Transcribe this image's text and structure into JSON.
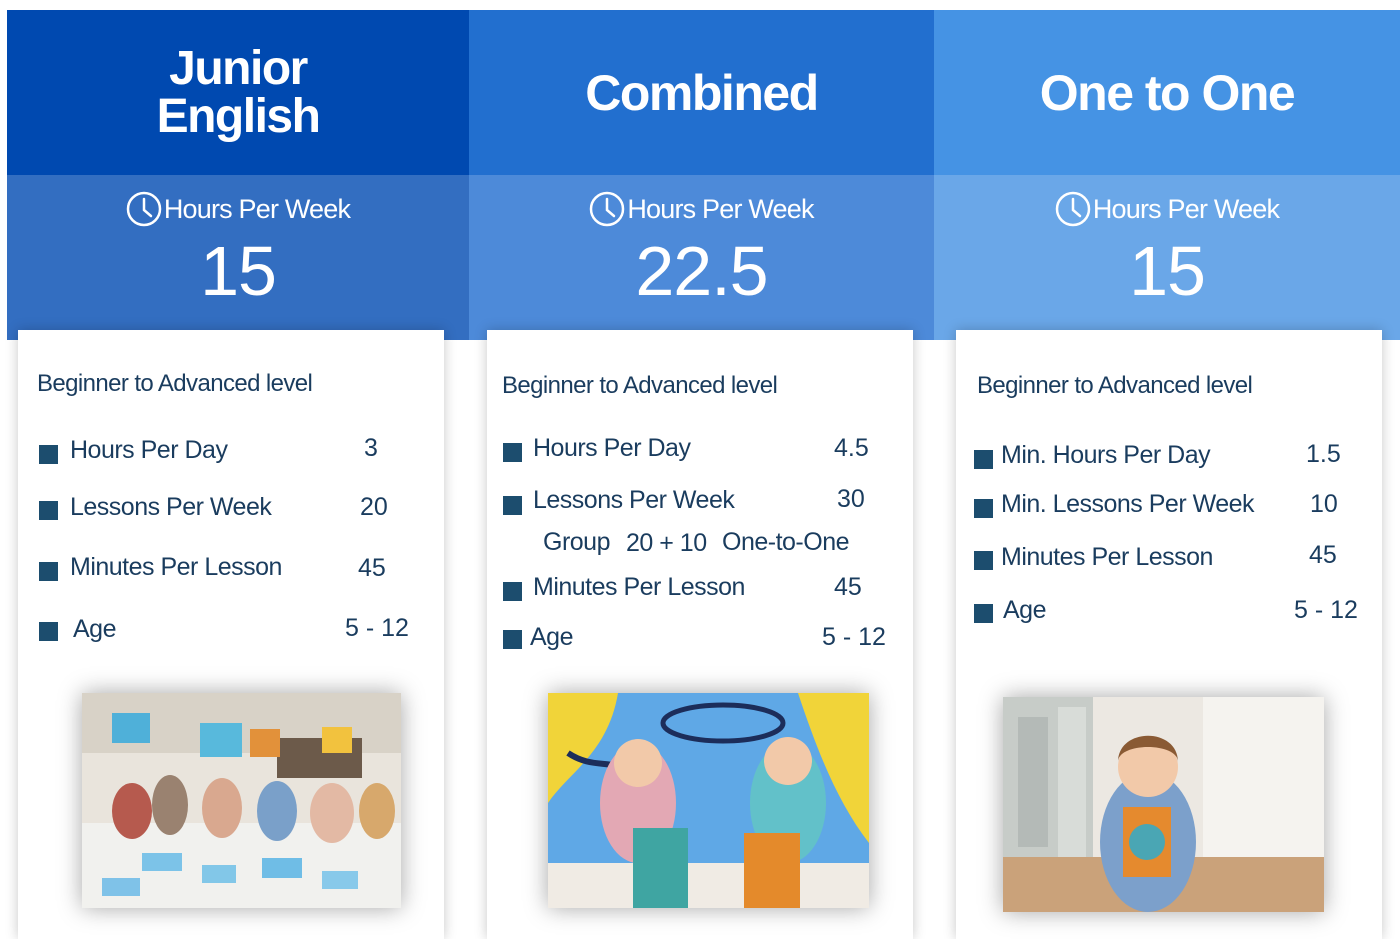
{
  "colors": {
    "col1_head": "#0049b0",
    "col1_band": "#336ec1",
    "col2_head": "#226fcf",
    "col2_band": "#4d8ad9",
    "col3_head": "#4593e4",
    "col3_band": "#6aa7e8",
    "bullet": "#1c4d6e",
    "text": "#1a3c5e"
  },
  "columns": [
    {
      "title_lines": [
        "Junior",
        "English"
      ],
      "hours_label": "Hours Per Week",
      "hours_value": "15",
      "level": "Beginner to Advanced level",
      "items": [
        {
          "label": "Hours Per Day",
          "value": "3"
        },
        {
          "label": "Lessons Per Week",
          "value": "20"
        },
        {
          "label": "Minutes Per Lesson",
          "value": "45"
        },
        {
          "label": "Age",
          "value": "5 - 12"
        }
      ],
      "photo": "children-classroom-photo"
    },
    {
      "title_lines": [
        "Combined"
      ],
      "hours_label": "Hours Per Week",
      "hours_value": "22.5",
      "level": "Beginner to Advanced level",
      "items": [
        {
          "label": "Hours Per Day",
          "value": "4.5"
        },
        {
          "label": "Lessons Per Week",
          "value": "30"
        },
        {
          "label": "Minutes Per Lesson",
          "value": "45"
        },
        {
          "label": "Age",
          "value": "5 - 12"
        }
      ],
      "sub": {
        "group": "Group",
        "mix": "20 + 10",
        "one": "One-to-One"
      },
      "photo": "two-girls-photo"
    },
    {
      "title_lines": [
        "One to One"
      ],
      "hours_label": "Hours Per Week",
      "hours_value": "15",
      "level": "Beginner to Advanced level",
      "items": [
        {
          "label": "Min. Hours Per Day",
          "value": "1.5"
        },
        {
          "label": "Min. Lessons Per Week",
          "value": "10"
        },
        {
          "label": "Minutes Per Lesson",
          "value": "45"
        },
        {
          "label": "Age",
          "value": "5 - 12"
        }
      ],
      "photo": "girl-with-book-photo"
    }
  ]
}
